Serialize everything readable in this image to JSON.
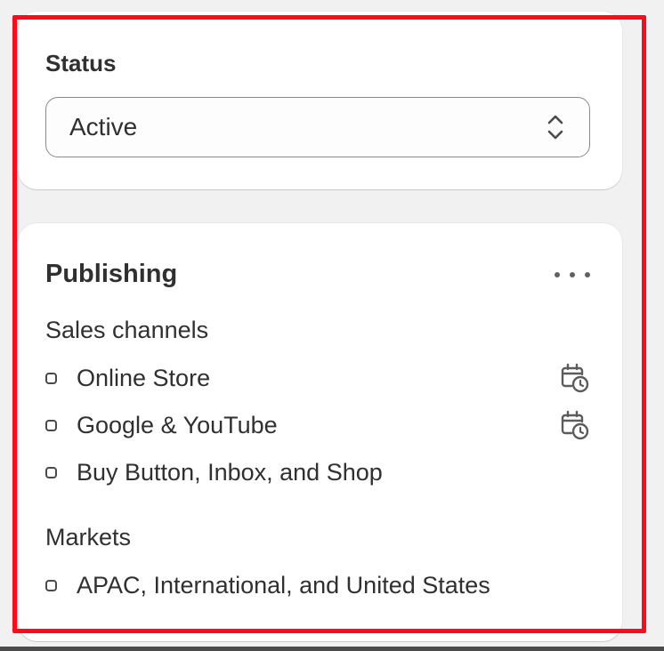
{
  "status_card": {
    "title": "Status",
    "select": {
      "value": "Active"
    }
  },
  "publishing_card": {
    "title": "Publishing",
    "more_icon": "more-horizontal-icon",
    "sales_channels": {
      "heading": "Sales channels",
      "items": [
        {
          "label": "Online Store",
          "icon": "calendar-schedule-icon"
        },
        {
          "label": "Google & YouTube",
          "icon": "calendar-schedule-icon"
        },
        {
          "label": "Buy Button, Inbox, and Shop"
        }
      ]
    },
    "markets": {
      "heading": "Markets",
      "items": [
        {
          "label": "APAC, International, and United States"
        }
      ]
    }
  },
  "colors": {
    "highlight": "#ff0a1a",
    "background": "#f1f1f1",
    "card": "#ffffff",
    "text": "#303030"
  }
}
